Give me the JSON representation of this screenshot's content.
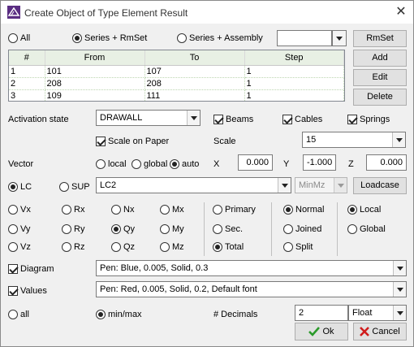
{
  "window": {
    "title": "Create Object of Type Element Result"
  },
  "top_radios": {
    "all": "All",
    "series_rmset": "Series + RmSet",
    "series_assembly": "Series + Assembly",
    "selected": "series_rmset"
  },
  "top_combo": {
    "value": ""
  },
  "side_buttons": {
    "rmset": "RmSet",
    "add": "Add",
    "edit": "Edit",
    "delete": "Delete"
  },
  "table": {
    "columns": [
      "#",
      "From",
      "To",
      "Step"
    ],
    "rows": [
      [
        "1",
        "101",
        "107",
        "1"
      ],
      [
        "2",
        "208",
        "208",
        "1"
      ],
      [
        "3",
        "109",
        "111",
        "1"
      ]
    ]
  },
  "activation": {
    "label": "Activation state",
    "value": "DRAWALL"
  },
  "checks": {
    "beams": "Beams",
    "cables": "Cables",
    "springs": "Springs",
    "scale_on_paper": "Scale on Paper"
  },
  "scale": {
    "label": "Scale",
    "value": "15"
  },
  "vector": {
    "label": "Vector",
    "local": "local",
    "global": "global",
    "auto": "auto",
    "selected": "auto",
    "x_label": "X",
    "x": "0.000",
    "y_label": "Y",
    "y": "-1.000",
    "z_label": "Z",
    "z": "0.000"
  },
  "lc": {
    "lc": "LC",
    "sup": "SUP",
    "selected": "LC",
    "value": "LC2",
    "minmax": "MinMz",
    "loadcase_button": "Loadcase"
  },
  "components": {
    "row1": [
      "Vx",
      "Rx",
      "Nx",
      "Mx"
    ],
    "row2": [
      "Vy",
      "Ry",
      "Qy",
      "My"
    ],
    "row3": [
      "Vz",
      "Rz",
      "Qz",
      "Mz"
    ],
    "selected": "Qy"
  },
  "section": {
    "primary": "Primary",
    "sec": "Sec.",
    "total": "Total",
    "selected": "Total"
  },
  "mode": {
    "normal": "Normal",
    "joined": "Joined",
    "split": "Split",
    "selected": "Normal"
  },
  "axes": {
    "local": "Local",
    "global": "Global",
    "selected": "Local"
  },
  "diagram": {
    "label": "Diagram",
    "value": "Pen: Blue, 0.005, Solid, 0.3"
  },
  "values": {
    "label": "Values",
    "value": "Pen: Red, 0.005, Solid, 0.2, Default font"
  },
  "filter": {
    "all": "all",
    "minmax": "min/max",
    "selected": "minmax"
  },
  "decimals": {
    "label": "# Decimals",
    "value": "2",
    "format": "Float"
  },
  "footer": {
    "ok": "Ok",
    "cancel": "Cancel"
  },
  "colors": {
    "ok_check": "#2a9a2a",
    "cancel_x": "#d01c1c",
    "grid_header": "#e8f0e4"
  }
}
